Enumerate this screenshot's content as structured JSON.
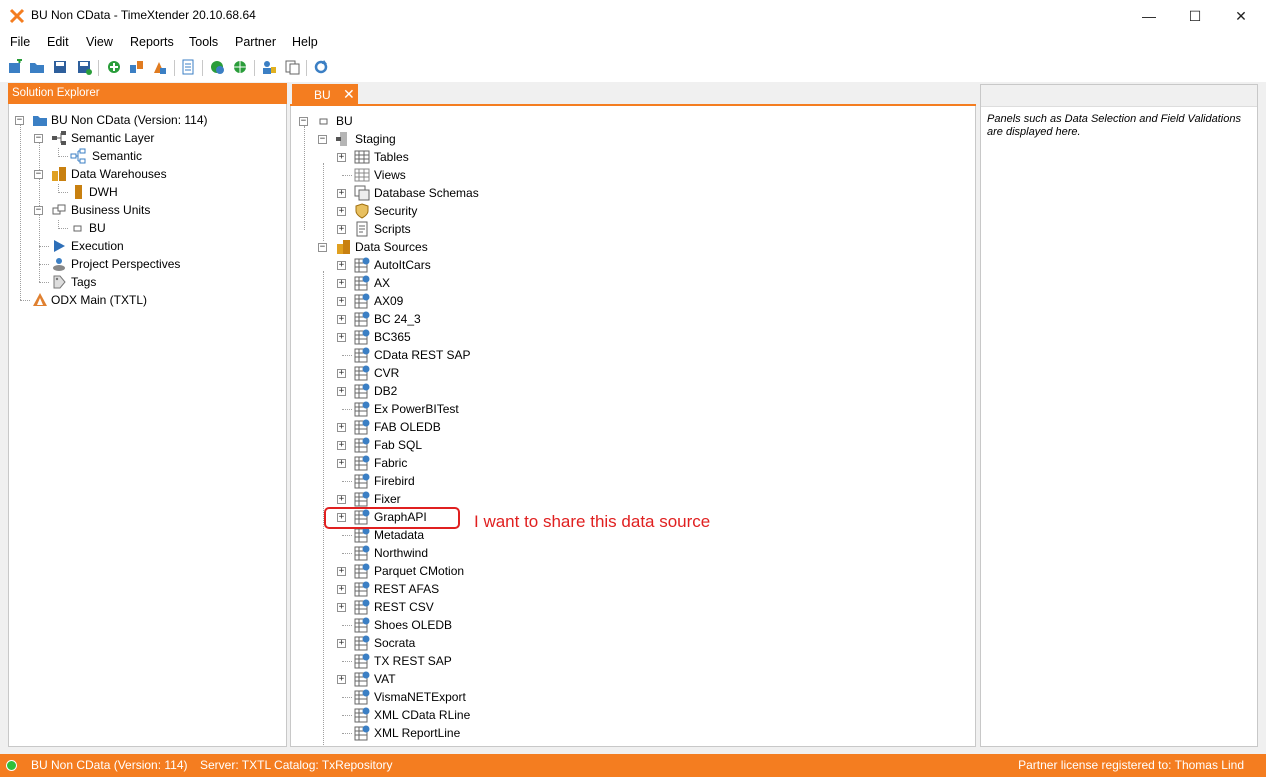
{
  "window": {
    "title": "BU Non CData - TimeXtender 20.10.68.64",
    "minimize_glyph": "—",
    "maximize_glyph": "☐",
    "close_glyph": "✕"
  },
  "menu": [
    "File",
    "Edit",
    "View",
    "Reports",
    "Tools",
    "Partner",
    "Help"
  ],
  "toolbar_icons": [
    "new-project-icon",
    "open-icon",
    "save-icon",
    "save-as-icon",
    "add-icon",
    "deploy-icon",
    "execute-icon",
    "document-icon",
    "sync-icon",
    "globe-icon",
    "users-icon",
    "copy-icon",
    "refresh-icon"
  ],
  "solution_explorer": {
    "header": "Solution Explorer",
    "nodes": [
      {
        "label": "BU Non CData (Version: 114)",
        "icon": "folder-icon"
      },
      {
        "label": "Semantic Layer",
        "icon": "semantic-layer-icon"
      },
      {
        "label": "Semantic",
        "icon": "semantic-model-icon"
      },
      {
        "label": "Data Warehouses",
        "icon": "data-warehouses-icon"
      },
      {
        "label": "DWH",
        "icon": "dwh-icon"
      },
      {
        "label": "Business Units",
        "icon": "business-units-icon"
      },
      {
        "label": "BU",
        "icon": "business-unit-icon"
      },
      {
        "label": "Execution",
        "icon": "execution-icon"
      },
      {
        "label": "Project Perspectives",
        "icon": "perspectives-icon"
      },
      {
        "label": "Tags",
        "icon": "tags-icon"
      },
      {
        "label": "ODX Main (TXTL)",
        "icon": "odx-icon"
      }
    ]
  },
  "document": {
    "tab_label": "BU",
    "tab_close": "✕",
    "root": "BU",
    "staging": "Staging",
    "staging_children": [
      "Tables",
      "Views",
      "Database Schemas",
      "Security",
      "Scripts"
    ],
    "data_sources_label": "Data Sources",
    "data_sources": [
      "AutoItCars",
      "AX",
      "AX09",
      "BC 24_3",
      "BC365",
      "CData REST SAP",
      "CVR",
      "DB2",
      "Ex PowerBITest",
      "FAB OLEDB",
      "Fab SQL",
      "Fabric",
      "Firebird",
      "Fixer",
      "GraphAPI",
      "Metadata",
      "Northwind",
      "Parquet CMotion",
      "REST AFAS",
      "REST CSV",
      "Shoes OLEDB",
      "Socrata",
      "TX REST SAP",
      "VAT",
      "VismaNETExport",
      "XML CData RLine",
      "XML ReportLine"
    ]
  },
  "properties_panel": {
    "note": "Panels such as Data Selection and Field Validations are displayed here."
  },
  "annotation": {
    "text": "I want to share this data source"
  },
  "status": {
    "project": "BU Non CData (Version: 114)",
    "server": "Server: TXTL Catalog: TxRepository",
    "license": "Partner license registered to: Thomas Lind"
  }
}
